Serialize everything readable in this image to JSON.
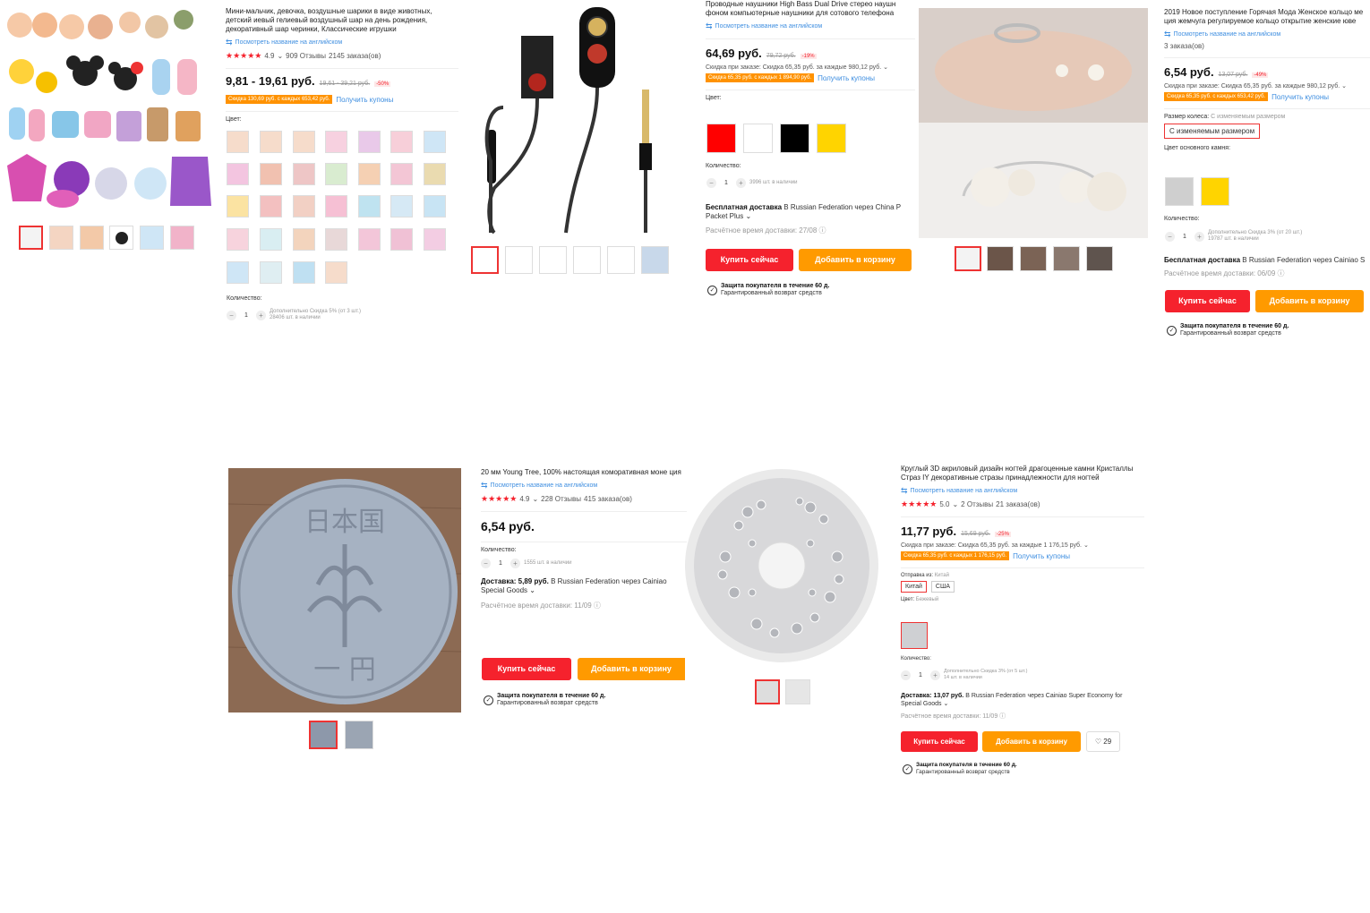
{
  "p1": {
    "title": "Мини-мальчик, девочка, воздушные шарики в виде животных, детский ​​иевый гелиевый воздушный шар на день рождения, декоративный шар черинки, Классические игрушки",
    "translate": "Посмотреть название на английском",
    "rating": "4.9",
    "reviews": "909 Отзывы",
    "orders": "2145 заказа(ов)",
    "price": "9,81 - 19,61 руб.",
    "old_price": "19,61 - 39,21 руб.",
    "discount": "-50%",
    "coupon": "Скидка 130,69 руб. с каждых 653,42 руб.",
    "get_coupons": "Получить купоны",
    "color_label": "Цвет:",
    "qty_label": "Количество:",
    "qty": "1",
    "stock_line1": "Дополнительно Скидка 5% (от 3 шт.)",
    "stock_line2": "28406 шт. в наличии"
  },
  "p2": {
    "title": "Проводные наушники High Bass Dual Drive стерео наушн фоном компьютерные наушники для сотового телефона",
    "translate": "Посмотреть название на английском",
    "price": "64,69 руб.",
    "old_price": "79,72 руб.",
    "discount": "-19%",
    "order_disc": "Скидка при заказе: Скидка 65,35 руб. за каждые 980,12 руб.",
    "coupon": "Скидка 65,35 руб. с каждых 1 894,90 руб.",
    "get_coupons": "Получить купоны",
    "color_label": "Цвет:",
    "colors": [
      "#ff0000",
      "#ffffff",
      "#000000",
      "#ffd400"
    ],
    "qty_label": "Количество:",
    "qty": "1",
    "stock": "3996 шт. в наличии",
    "shipping_bold": "Бесплатная доставка",
    "shipping_rest": " В Russian Federation через China P Packet Plus",
    "delivery": "Расчётное время доставки: 27/08",
    "buy": "Купить сейчас",
    "cart": "Добавить в корзину",
    "protect": "Защита покупателя в течение 60 д.",
    "return": "Гарантированный возврат средств"
  },
  "p3": {
    "title": "2019 Новое поступление Горячая Мода Женское кольцо ме ция жемчуга регулируемое кольцо открытие женские юве",
    "translate": "Посмотреть название на английском",
    "orders": "3 заказа(ов)",
    "price": "6,54 руб.",
    "old_price": "13,07 руб.",
    "discount": "-49%",
    "order_disc": "Скидка при заказе: Скидка 65,35 руб. за каждые 980,12 руб.",
    "coupon": "Скидка 65,35 руб. с каждых 653,42 руб.",
    "get_coupons": "Получить купоны",
    "size_label": "Размер колеса:",
    "size_value": "С изменяемым размером",
    "size_option": "С изменяемым размером",
    "stone_label": "Цвет основного камня:",
    "colors": [
      "#cfcfcf",
      "#ffd400"
    ],
    "qty_label": "Количество:",
    "qty": "1",
    "stock_line1": "Дополнительно Скидка 3% (от 20 шт.)",
    "stock_line2": "19787 шт. в наличии",
    "shipping_bold": "Бесплатная доставка",
    "shipping_rest": " В Russian Federation через Cainiao S",
    "delivery": "Расчётное время доставки: 06/09",
    "buy": "Купить сейчас",
    "cart": "Добавить в корзину",
    "protect": "Защита покупателя в течение 60 д.",
    "return": "Гарантированный возврат средств"
  },
  "p4": {
    "title": "20 мм Young Tree, 100% настоящая коморативная моне ция",
    "translate": "Посмотреть название на английском",
    "rating": "4.9",
    "reviews": "228 Отзывы",
    "orders": "415 заказа(ов)",
    "price": "6,54 руб.",
    "qty_label": "Количество:",
    "qty": "1",
    "stock": "1555 шт. в наличии",
    "shipping_bold": "Доставка: 5,89 руб.",
    "shipping_rest": " В Russian Federation через Cainiao Special Goods",
    "delivery": "Расчётное время доставки: 11/09",
    "buy": "Купить сейчас",
    "cart": "Добавить в корзину",
    "protect": "Защита покупателя в течение 60 д.",
    "return": "Гарантированный возврат средств",
    "coin_text_top": "日本国",
    "coin_text_bottom": "一 円"
  },
  "p5": {
    "title": "Круглый 3D акриловый дизайн ногтей драгоценные камни Кристаллы Страз IY декоративные стразы принадлежности для ногтей",
    "translate": "Посмотреть название на английском",
    "rating": "5.0",
    "reviews": "2 Отзывы",
    "orders": "21 заказа(ов)",
    "price": "11,77 руб.",
    "old_price": "15,69 руб.",
    "discount": "-25%",
    "order_disc": "Скидка при заказе: Скидка 65,35 руб. за каждые 1 176,15 руб.",
    "coupon": "Скидка 65,35 руб. с каждых 1 176,15 руб.",
    "get_coupons": "Получить купоны",
    "ship_from_label": "Отправка из:",
    "ship_from_value": "Китай",
    "ship_opts": [
      "Китай",
      "США"
    ],
    "color_label": "Цвет:",
    "color_value": "Бежевый",
    "qty_label": "Количество:",
    "qty": "1",
    "stock_line1": "Дополнительно Скидка 3% (от 5 шт.)",
    "stock_line2": "14 шт. в наличии",
    "shipping_bold": "Доставка: 13,07 руб.",
    "shipping_rest": " В Russian Federation через Cainiao Super Economy for Special Goods",
    "delivery": "Расчётное время доставки: 11/09",
    "buy": "Купить сейчас",
    "cart": "Добавить в корзину",
    "wish_count": "29",
    "protect": "Защита покупателя в течение 60 д.",
    "return": "Гарантированный возврат средств"
  }
}
